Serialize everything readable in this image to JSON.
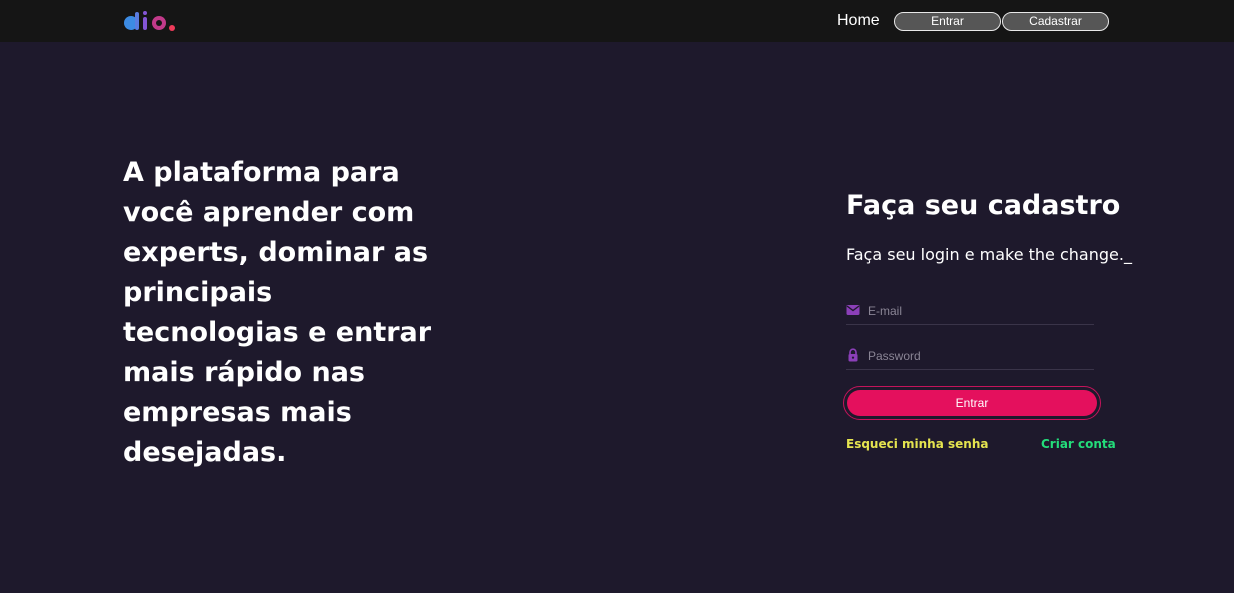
{
  "header": {
    "logo_icon": "dio-logo",
    "nav_home": "Home",
    "login_button": "Entrar",
    "signup_button": "Cadastrar"
  },
  "hero": {
    "headline": "A plataforma para você aprender com experts, dominar as principais tecnologias e entrar mais rápido nas empresas mais desejadas."
  },
  "form": {
    "title": "Faça seu cadastro",
    "subtitle": "Faça seu login e make the change._",
    "email_placeholder": "E-mail",
    "email_value": "",
    "email_icon": "mail-icon",
    "password_placeholder": "Password",
    "password_value": "",
    "password_icon": "lock-icon",
    "submit_label": "Entrar",
    "forgot_link": "Esqueci minha senha",
    "create_link": "Criar conta"
  },
  "colors": {
    "page_background": "#1e192c",
    "header_background": "#151515",
    "accent_pink": "#e4105d",
    "icon_purple": "#8b3fb8",
    "forgot_yellow": "#e5e44f",
    "create_green": "#23dd7a"
  }
}
